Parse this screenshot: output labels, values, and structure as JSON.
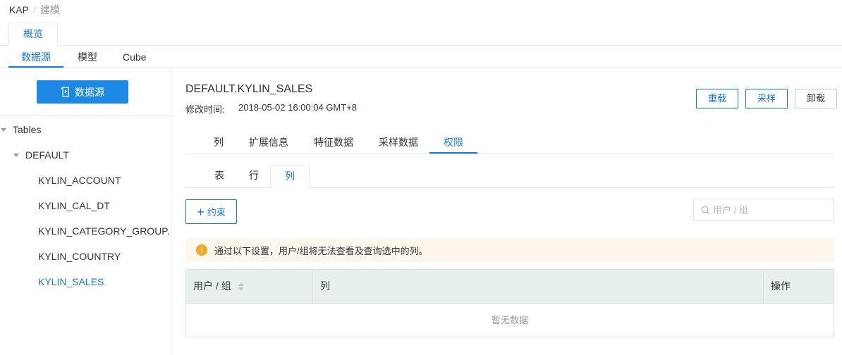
{
  "breadcrumb": {
    "root": "KAP",
    "separator": "/",
    "current": "建模"
  },
  "top_tab": {
    "label": "概览"
  },
  "sub_tabs": {
    "datasource": "数据源",
    "model": "模型",
    "cube": "Cube"
  },
  "sidebar": {
    "datasource_button": "数据源",
    "tree": {
      "root": "Tables",
      "database": "DEFAULT",
      "tables": [
        "KYLIN_ACCOUNT",
        "KYLIN_CAL_DT",
        "KYLIN_CATEGORY_GROUP...",
        "KYLIN_COUNTRY",
        "KYLIN_SALES"
      ],
      "active_table": "KYLIN_SALES"
    }
  },
  "detail": {
    "title": "DEFAULT.KYLIN_SALES",
    "modified_label": "修改时间:",
    "modified_value": "2018-05-02 16:00:04 GMT+8",
    "buttons": {
      "reload": "重载",
      "sample": "采样",
      "unload": "卸载"
    },
    "info_tabs": {
      "columns": "列",
      "extended": "扩展信息",
      "features": "特征数据",
      "sample_data": "采样数据",
      "permissions": "权限"
    },
    "perm_tabs": {
      "table": "表",
      "row": "行",
      "column": "列"
    },
    "constraint_button": "约束",
    "search": {
      "placeholder": "用户 / 组"
    },
    "alert": "通过以下设置，用户/组将无法查看及查询选中的列。",
    "table": {
      "col_user": "用户 / 组",
      "col_columns": "列",
      "col_ops": "操作",
      "empty": "暂无数据"
    }
  },
  "colors": {
    "primary": "#1976d2",
    "button_bg": "#1e88e5",
    "warning": "#f5a623",
    "alert_bg": "#fdf6ec",
    "table_header_bg": "#e8f0ef"
  }
}
